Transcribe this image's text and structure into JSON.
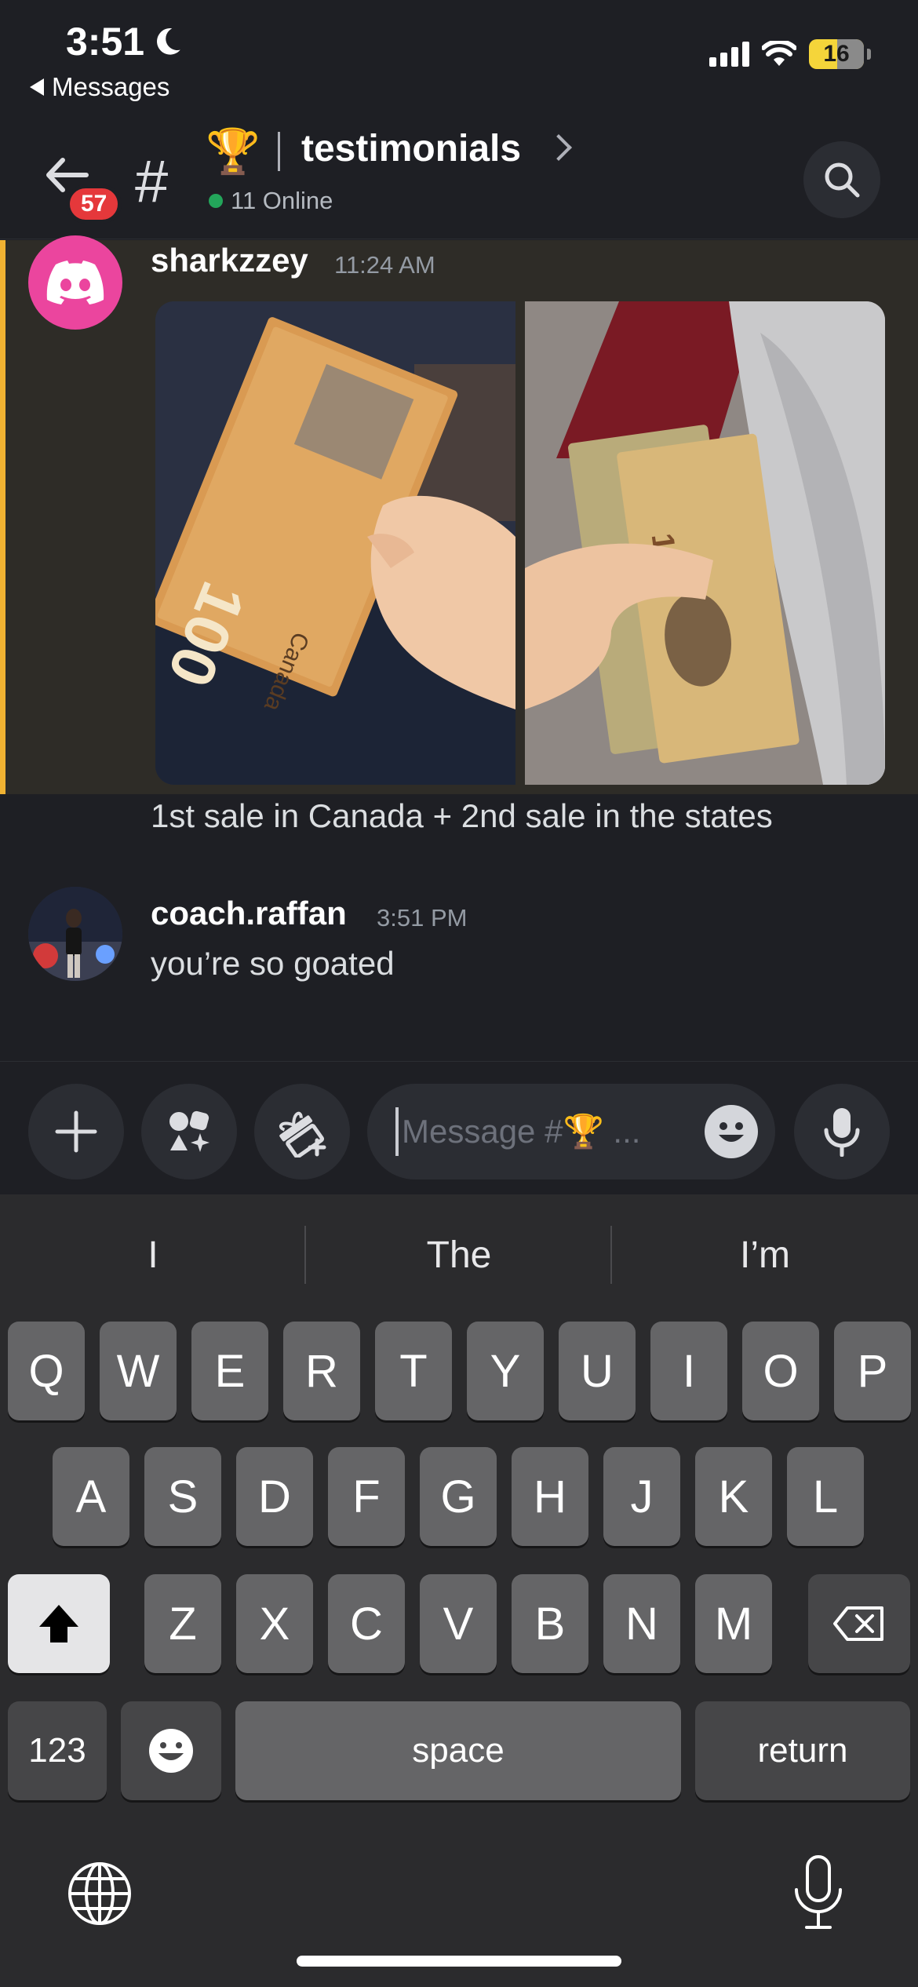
{
  "status_bar": {
    "time": "3:51",
    "back_label": "Messages",
    "battery": "16",
    "colors": {
      "battery": "#f5d53a"
    }
  },
  "header": {
    "unread_badge": "57",
    "channel_emoji": "🏆",
    "channel_name": "testimonials",
    "online_text": "11 Online",
    "icons": [
      "back-arrow-icon",
      "hash-icon",
      "chevron-right-icon",
      "search-icon"
    ]
  },
  "messages": [
    {
      "author": "sharkzzey",
      "time": "11:24 AM",
      "attachments": [
        "canadian-100-bill-photo",
        "us-10-bills-photo"
      ],
      "text": "1st sale in Canada + 2nd sale in the states",
      "highlighted": true
    },
    {
      "author": "coach.raffan",
      "time": "3:51 PM",
      "text": "you’re so goated"
    }
  ],
  "composer": {
    "placeholder": "Message #🏆 ...",
    "buttons": [
      "plus-icon",
      "apps-icon",
      "gift-icon",
      "emoji-icon",
      "microphone-icon"
    ]
  },
  "keyboard": {
    "predictions": [
      "I",
      "The",
      "I’m"
    ],
    "row1": [
      "Q",
      "W",
      "E",
      "R",
      "T",
      "Y",
      "U",
      "I",
      "O",
      "P"
    ],
    "row2": [
      "A",
      "S",
      "D",
      "F",
      "G",
      "H",
      "J",
      "K",
      "L"
    ],
    "row3": [
      "Z",
      "X",
      "C",
      "V",
      "B",
      "N",
      "M"
    ],
    "numbers_key": "123",
    "space_key": "space",
    "return_key": "return"
  },
  "colors": {
    "background": "#1e1f24",
    "highlight_bar": "#f0b232",
    "badge": "#e5383b",
    "online": "#23a55a",
    "discord_avatar": "#eb459e"
  }
}
